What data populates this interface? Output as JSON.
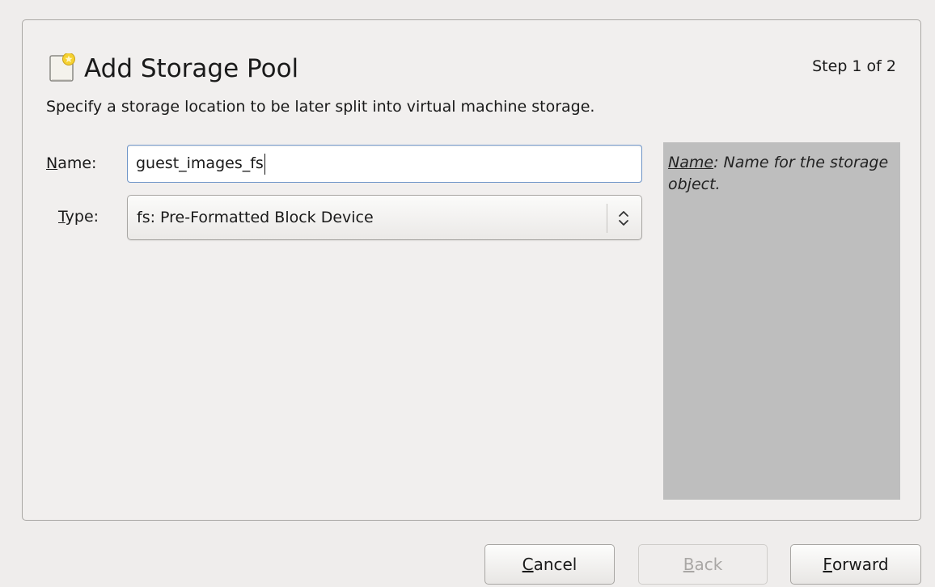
{
  "header": {
    "title": "Add Storage Pool",
    "step": "Step 1 of 2",
    "subtitle": "Specify a storage location to be later split into virtual machine storage.",
    "icon": "storage-pool-icon"
  },
  "form": {
    "name_label_mnemonic": "N",
    "name_label_rest": "ame:",
    "name_value": "guest_images_fs",
    "type_label_mnemonic": "T",
    "type_label_rest": "ype:",
    "type_value": "fs: Pre-Formatted Block Device"
  },
  "help": {
    "term": "Name",
    "text": ": Name for the storage object."
  },
  "buttons": {
    "cancel_mnemonic": "C",
    "cancel_rest": "ancel",
    "back_mnemonic": "B",
    "back_rest": "ack",
    "forward_mnemonic": "F",
    "forward_rest": "orward"
  },
  "colors": {
    "background": "#efedec",
    "help_panel": "#bebebe",
    "focus_border": "#6f95c8",
    "icon_star": "#f5d130"
  }
}
